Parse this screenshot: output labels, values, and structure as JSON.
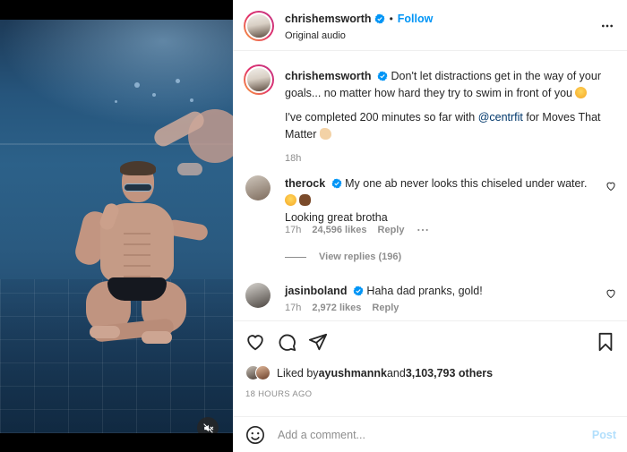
{
  "post": {
    "author": "chrishemsworth",
    "follow_label": "Follow",
    "audio": "Original audio",
    "caption_line1": "Don't let distractions get in the way of your goals... no matter how hard they try to swim in front of you",
    "caption_line2_pre": "I've completed 200 minutes so far with ",
    "caption_mention": "@centrfit",
    "caption_line2_post": " for Moves That Matter",
    "caption_time": "18h"
  },
  "comments": [
    {
      "username": "therock",
      "text": "My one ab never looks this chiseled under water.",
      "text2": "Looking great brotha",
      "time": "17h",
      "likes": "24,596 likes",
      "reply": "Reply",
      "view_replies": "View replies (196)"
    },
    {
      "username": "jasinboland",
      "text": "Haha dad pranks, gold!",
      "time": "17h",
      "likes": "2,972 likes",
      "reply": "Reply"
    }
  ],
  "likes_line": {
    "prefix": "Liked by ",
    "user": "ayushmannk",
    "middle": " and ",
    "count": "3,103,793 others"
  },
  "posted_time": "18 HOURS AGO",
  "comment_box": {
    "placeholder": "Add a comment...",
    "post_label": "Post"
  },
  "icons": [
    "verified-icon",
    "more-options-icon",
    "heart-icon",
    "comment-icon",
    "share-icon",
    "save-icon",
    "emoji-icon",
    "muted-icon"
  ],
  "colors": {
    "accent": "#0095f6",
    "verified": "#0095f6",
    "muted_text": "#8e8e8e",
    "post_disabled": "#b2dffc"
  }
}
